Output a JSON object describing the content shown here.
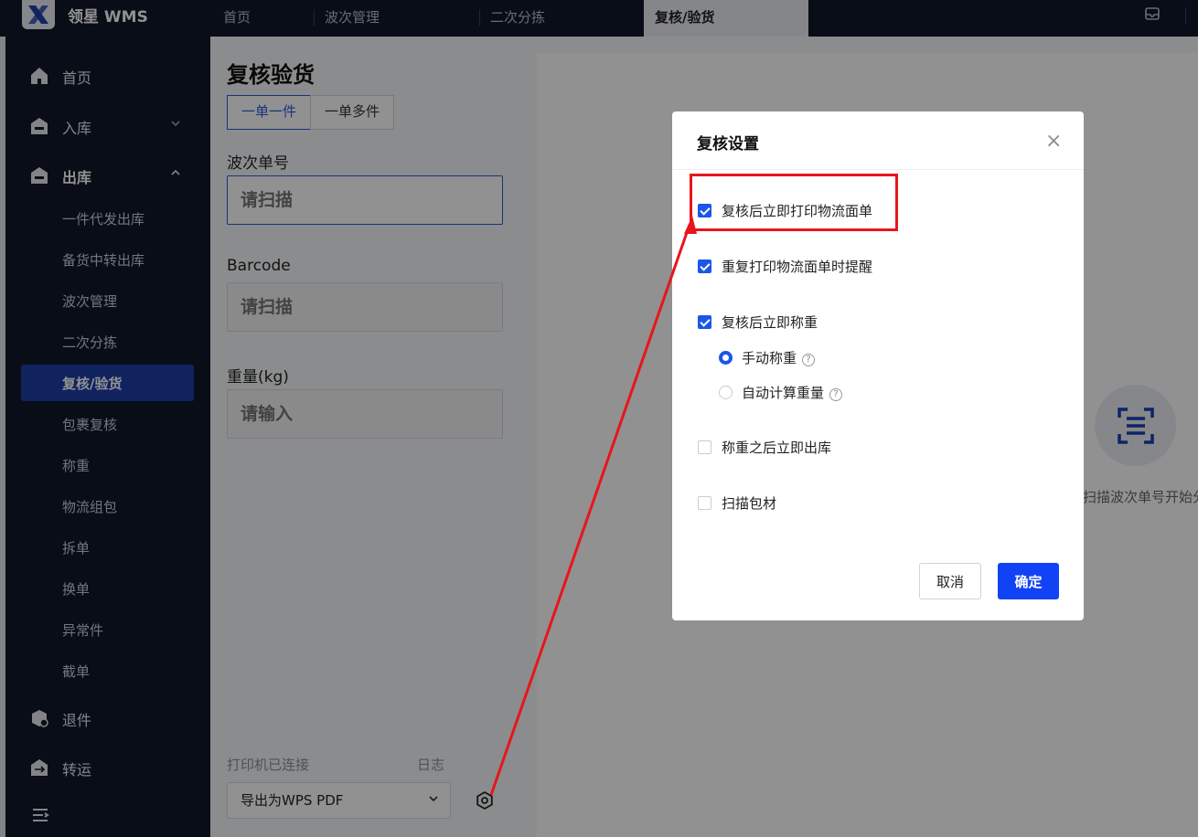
{
  "app": {
    "name": "领星 WMS"
  },
  "tabs": [
    {
      "label": "首页"
    },
    {
      "label": "波次管理"
    },
    {
      "label": "二次分拣"
    },
    {
      "label": "复核/验货"
    }
  ],
  "sidebar": {
    "items": [
      {
        "label": "首页"
      },
      {
        "label": "入库"
      },
      {
        "label": "出库"
      },
      {
        "label": "退件"
      },
      {
        "label": "转运"
      }
    ],
    "outbound_sub": [
      {
        "label": "一件代发出库"
      },
      {
        "label": "备货中转出库"
      },
      {
        "label": "波次管理"
      },
      {
        "label": "二次分拣"
      },
      {
        "label": "复核/验货"
      },
      {
        "label": "包裹复核"
      },
      {
        "label": "称重"
      },
      {
        "label": "物流组包"
      },
      {
        "label": "拆单"
      },
      {
        "label": "换单"
      },
      {
        "label": "异常件"
      },
      {
        "label": "截单"
      }
    ]
  },
  "main": {
    "title": "复核验货",
    "mode_single": "一单一件",
    "mode_multi": "一单多件",
    "wave_label": "波次单号",
    "wave_placeholder": "请扫描",
    "barcode_label": "Barcode",
    "barcode_placeholder": "请扫描",
    "weight_label": "重量(kg)",
    "weight_placeholder": "请输入",
    "printer_status": "打印机已连接",
    "log_link": "日志",
    "printer_selected": "导出为WPS PDF",
    "scan_hint": "扫描波次单号开始分"
  },
  "modal": {
    "title": "复核设置",
    "close": "×",
    "options": [
      {
        "label": "复核后立即打印物流面单",
        "checked": true
      },
      {
        "label": "重复打印物流面单时提醒",
        "checked": true
      },
      {
        "label": "复核后立即称重",
        "checked": true
      },
      {
        "label": "称重之后立即出库",
        "checked": false
      },
      {
        "label": "扫描包材",
        "checked": false
      }
    ],
    "weigh_modes": [
      {
        "label": "手动称重",
        "selected": true
      },
      {
        "label": "自动计算重量",
        "selected": false
      }
    ],
    "help_glyph": "?",
    "cancel": "取消",
    "confirm": "确定"
  },
  "colors": {
    "primary": "#1242f5",
    "sidebar_bg": "#0f1729",
    "active_menu": "#1f3fa8",
    "annotation_red": "#e8151c"
  }
}
